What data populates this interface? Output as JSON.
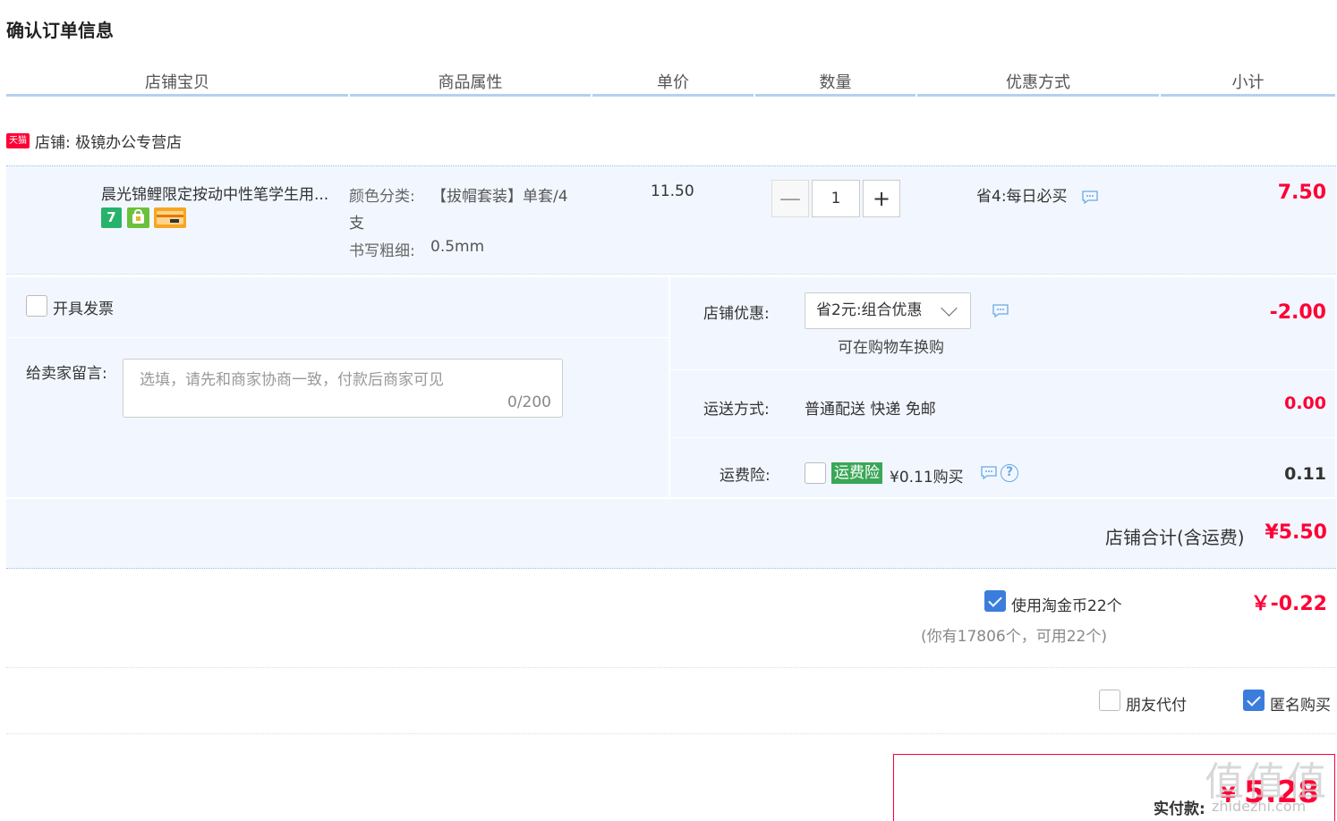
{
  "page_title": "确认订单信息",
  "columns": [
    "店铺宝贝",
    "商品属性",
    "单价",
    "数量",
    "优惠方式",
    "小计"
  ],
  "shop": {
    "badge": "天猫",
    "label": "店铺: 极镜办公专营店"
  },
  "item": {
    "title": "晨光锦鲤限定按动中性笔学生用...",
    "icon_labels": [
      "7"
    ],
    "attr_color_label": "颜色分类:",
    "attr_color_value_1": "【拔帽套装】单套/4",
    "attr_color_value_2": "支",
    "attr_width_label": "书写粗细:",
    "attr_width_value": "0.5mm",
    "unit_price": "11.50",
    "qty_minus": "—",
    "quantity": "1",
    "qty_plus": "+",
    "discount": "省4:每日必买",
    "subtotal": "7.50"
  },
  "invoice": {
    "label": "开具发票"
  },
  "message": {
    "label": "给卖家留言:",
    "placeholder": "选填，请先和商家协商一致，付款后商家可见",
    "counter": "0/200"
  },
  "shop_discount": {
    "label": "店铺优惠:",
    "selected": "省2元:组合优惠",
    "hint": "可在购物车换购",
    "amount": "-2.00"
  },
  "shipping": {
    "label": "运送方式:",
    "value": "普通配送 快递 免邮",
    "amount": "0.00"
  },
  "insurance": {
    "label": "运费险:",
    "tag": "运费险",
    "price": "¥0.11购买",
    "amount": "0.11"
  },
  "shop_total": {
    "label": "店铺合计(含运费)",
    "amount": "¥5.50"
  },
  "taojinbi": {
    "label": "使用淘金币22个",
    "note": "(你有17806个，可用22个)",
    "amount": "￥-0.22",
    "checked": true
  },
  "options": {
    "friend_pay": "朋友代付",
    "anonymous": "匿名购买"
  },
  "payment": {
    "label": "实付款:",
    "currency": "¥",
    "amount": "5.28"
  },
  "watermark": {
    "glyphs": "值值值",
    "url": "zhidezhi.com"
  },
  "colors": {
    "accent_red": "#ff0036",
    "header_line": "#b2d1f0",
    "panel_bg": "#f2f7ff",
    "checkbox_blue": "#3b7ddd",
    "insurance_green": "#3aa757"
  }
}
